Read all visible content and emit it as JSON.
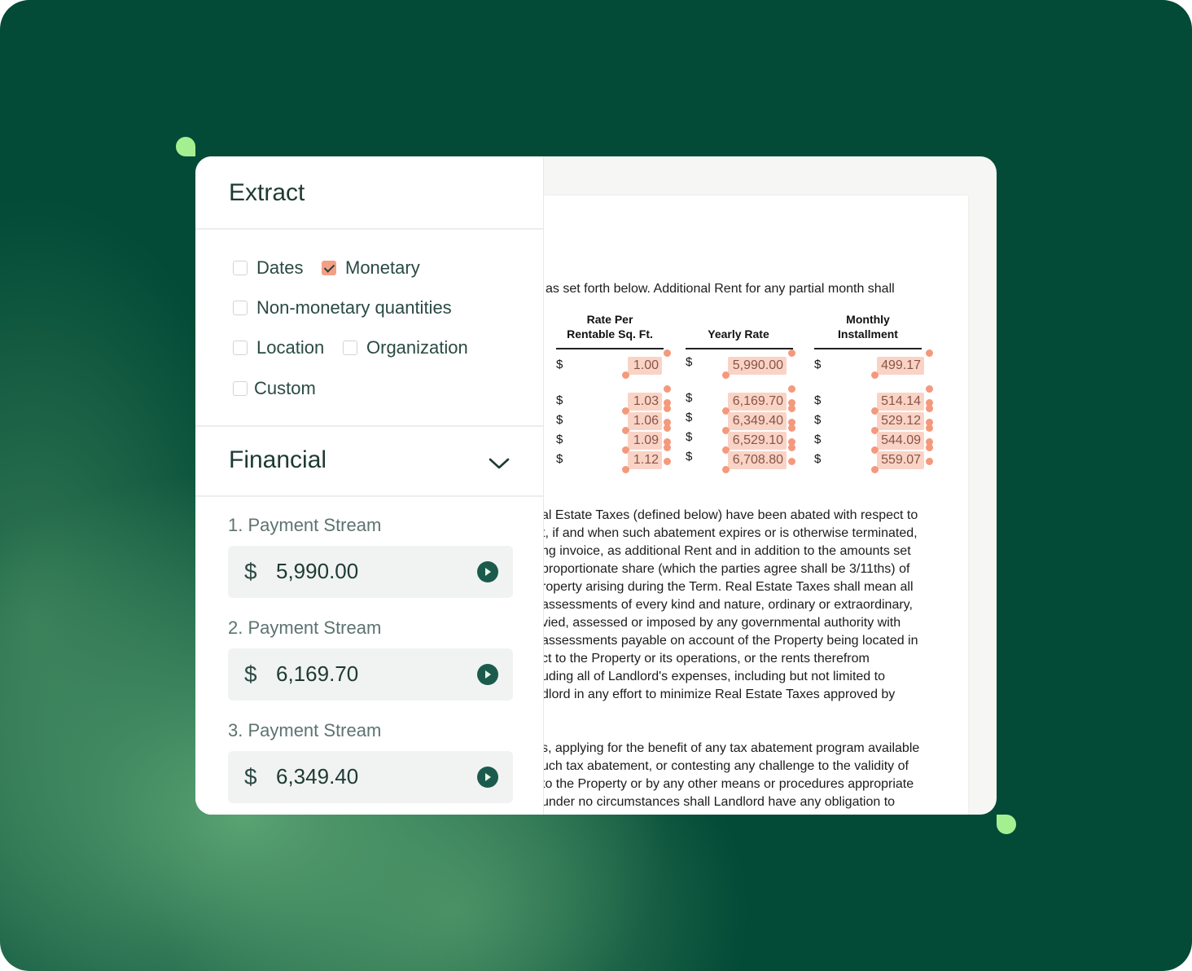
{
  "panel": {
    "title": "Extract",
    "filters": [
      {
        "label": "Dates",
        "checked": false
      },
      {
        "label": "Monetary",
        "checked": true
      },
      {
        "label": "Non-monetary quantities",
        "checked": false
      },
      {
        "label": "Location",
        "checked": false
      },
      {
        "label": "Organization",
        "checked": false
      },
      {
        "label": "Custom",
        "checked": false
      }
    ],
    "section_title": "Financial",
    "streams": [
      {
        "label": "1. Payment Stream",
        "currency": "$",
        "value": "5,990.00"
      },
      {
        "label": "2. Payment Stream",
        "currency": "$",
        "value": "6,169.70"
      },
      {
        "label": "3. Payment Stream",
        "currency": "$",
        "value": "6,349.40"
      }
    ]
  },
  "document": {
    "intro_line": "as set forth below. Additional Rent for any partial month shall",
    "table": {
      "headers": [
        "Rate Per",
        "Rentable Sq. Ft.",
        "Yearly Rate",
        "Monthly",
        "Installment"
      ],
      "currency": "$",
      "rate_per_sqft": [
        "1.00",
        "1.03",
        "1.06",
        "1.09",
        "1.12"
      ],
      "yearly_rate": [
        "5,990.00",
        "6,169.70",
        "6,349.40",
        "6,529.10",
        "6,708.80"
      ],
      "monthly_installment": [
        "499.17",
        "514.14",
        "529.12",
        "544.09",
        "559.07"
      ]
    },
    "paragraph1": [
      "al Estate Taxes (defined below) have been abated with respect to",
      "t, if and when such abatement expires or is otherwise terminated,",
      "ng invoice, as additional Rent and in addition to the amounts set",
      "proportionate share (which the parties agree shall be 3/11ths) of",
      "roperty arising during the Term. Real Estate Taxes shall mean all",
      "assessments of every kind and nature, ordinary or extraordinary,",
      "vied, assessed or imposed by any governmental authority with",
      "assessments payable on account of the Property being located in",
      "ct to the Property or its operations, or the rents therefrom",
      "uding all of Landlord's expenses, including but not limited to",
      "dlord in any effort to minimize Real Estate Taxes approved by"
    ],
    "paragraph2": [
      "s, applying for the benefit of any tax abatement program available",
      "uch tax abatement, or contesting any challenge to the validity of",
      "to the Property or by any other means or procedures appropriate",
      "under no circumstances shall Landlord have any obligation to"
    ]
  },
  "colors": {
    "background": "#034a37",
    "accent_leaf": "#a4f091",
    "highlight": "#f9d4c6",
    "highlight_dot": "#f4997c",
    "play_button": "#1b5b4d"
  }
}
